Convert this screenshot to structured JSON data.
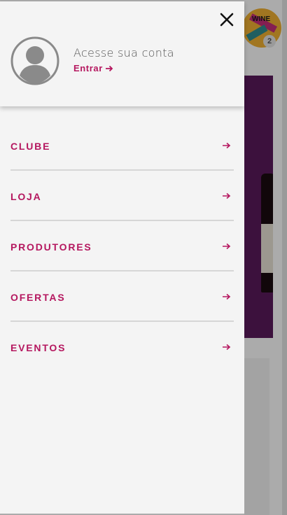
{
  "header": {
    "close_icon": "close-icon"
  },
  "account": {
    "title": "Acesse sua conta",
    "login_label": "Entrar",
    "avatar_icon": "user-avatar-icon"
  },
  "menu": {
    "items": [
      {
        "label": "CLUBE"
      },
      {
        "label": "LOJA"
      },
      {
        "label": "PRODUTORES"
      },
      {
        "label": "OFERTAS"
      },
      {
        "label": "EVENTOS"
      }
    ]
  },
  "background": {
    "cart_count": "2",
    "brand_logo_text": "WINE"
  },
  "colors": {
    "accent": "#b5175f",
    "drawer_bg": "#f4f4f4",
    "text_muted": "#555555",
    "divider": "#d6d6d6"
  }
}
